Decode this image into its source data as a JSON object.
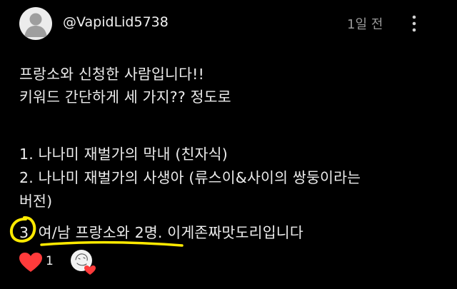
{
  "comment": {
    "username": "@VapidLid5738",
    "timestamp": "1일 전",
    "lines": [
      "프랑소와 신청한 사람입니다!!",
      "키워드 간단하게 세 가지?? 정도로",
      "1. 나나미 재벌가의 막내 (친자식)",
      "2. 나나미 재벌가의 사생아 (류스이&사이의 쌍둥이라는",
      "버전)",
      "3. 여/남 프랑소와 2명. 이게존짜맛도리입니다"
    ]
  },
  "actions": {
    "like_count": "1",
    "like_icon": "heart-icon",
    "creator_heart_icon": "creator-heart-icon",
    "like_color": "#ff3b3b"
  },
  "annotation": {
    "color": "#ffea00"
  }
}
